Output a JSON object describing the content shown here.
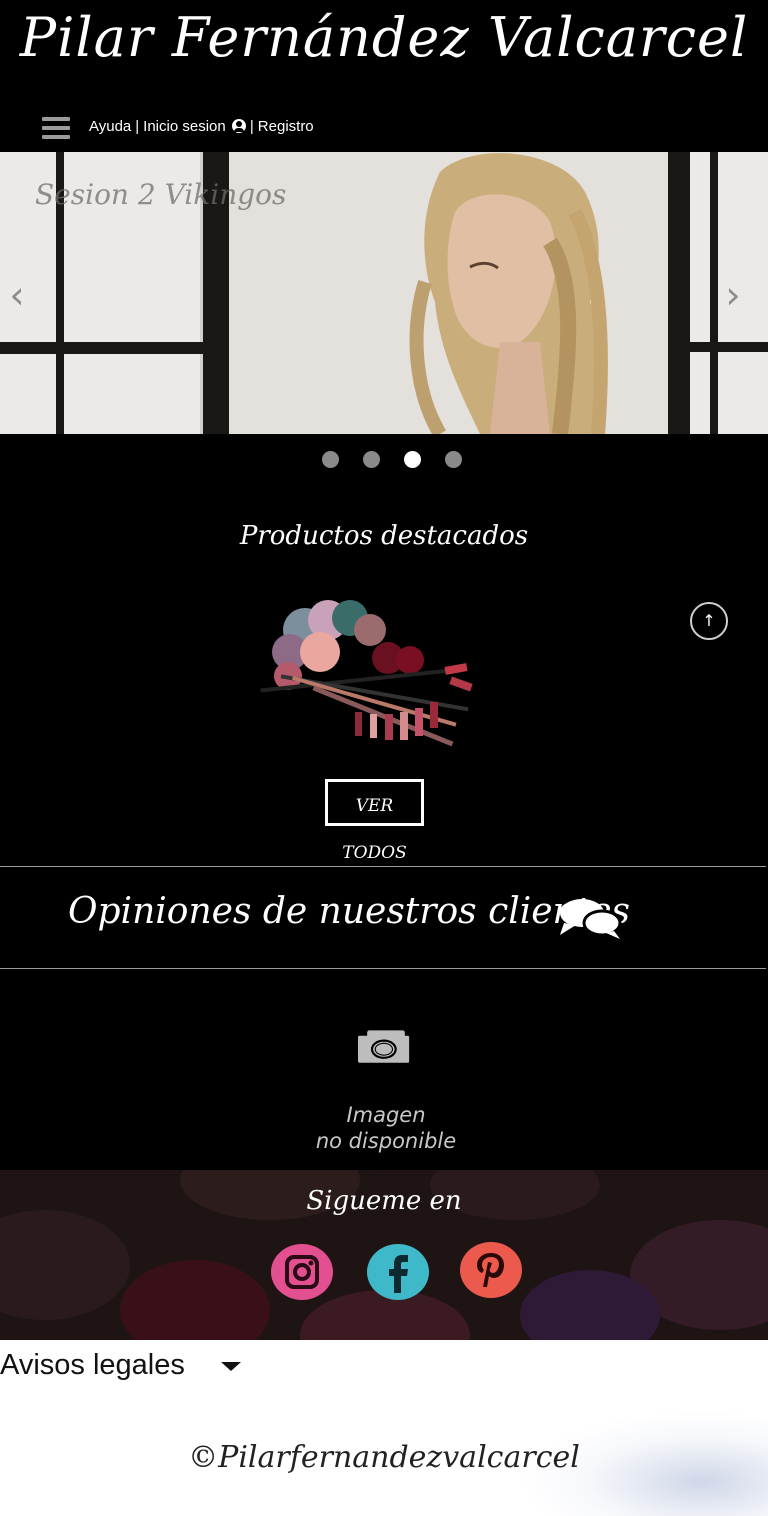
{
  "header": {
    "site_title": "Pilar Fernández Valcarcel",
    "nav": {
      "help": "Ayuda",
      "separator": "|",
      "login": "Inicio sesion",
      "register": "Registro"
    }
  },
  "carousel": {
    "caption": "Sesion 2 Vikingos",
    "prev_icon": "chevron-left-icon",
    "next_icon": "chevron-right-icon",
    "slide_count": 4,
    "active_index": 2
  },
  "featured": {
    "title": "Productos destacados",
    "see_all_label": "VER TODOS"
  },
  "opinions": {
    "title": "Opiniones de nuestros clientes",
    "icon": "comments-icon",
    "placeholder_line1": "Imagen",
    "placeholder_line2": "no disponible"
  },
  "follow": {
    "title": "Sigueme en",
    "networks": [
      "instagram",
      "facebook",
      "pinterest"
    ]
  },
  "footer": {
    "legal_label": "Avisos legales",
    "copyright": "©Pilarfernandezvalcarcel"
  },
  "colors": {
    "background": "#000000",
    "instagram": "#e2508f",
    "facebook": "#3fb8c9",
    "pinterest": "#ec5a4d"
  }
}
